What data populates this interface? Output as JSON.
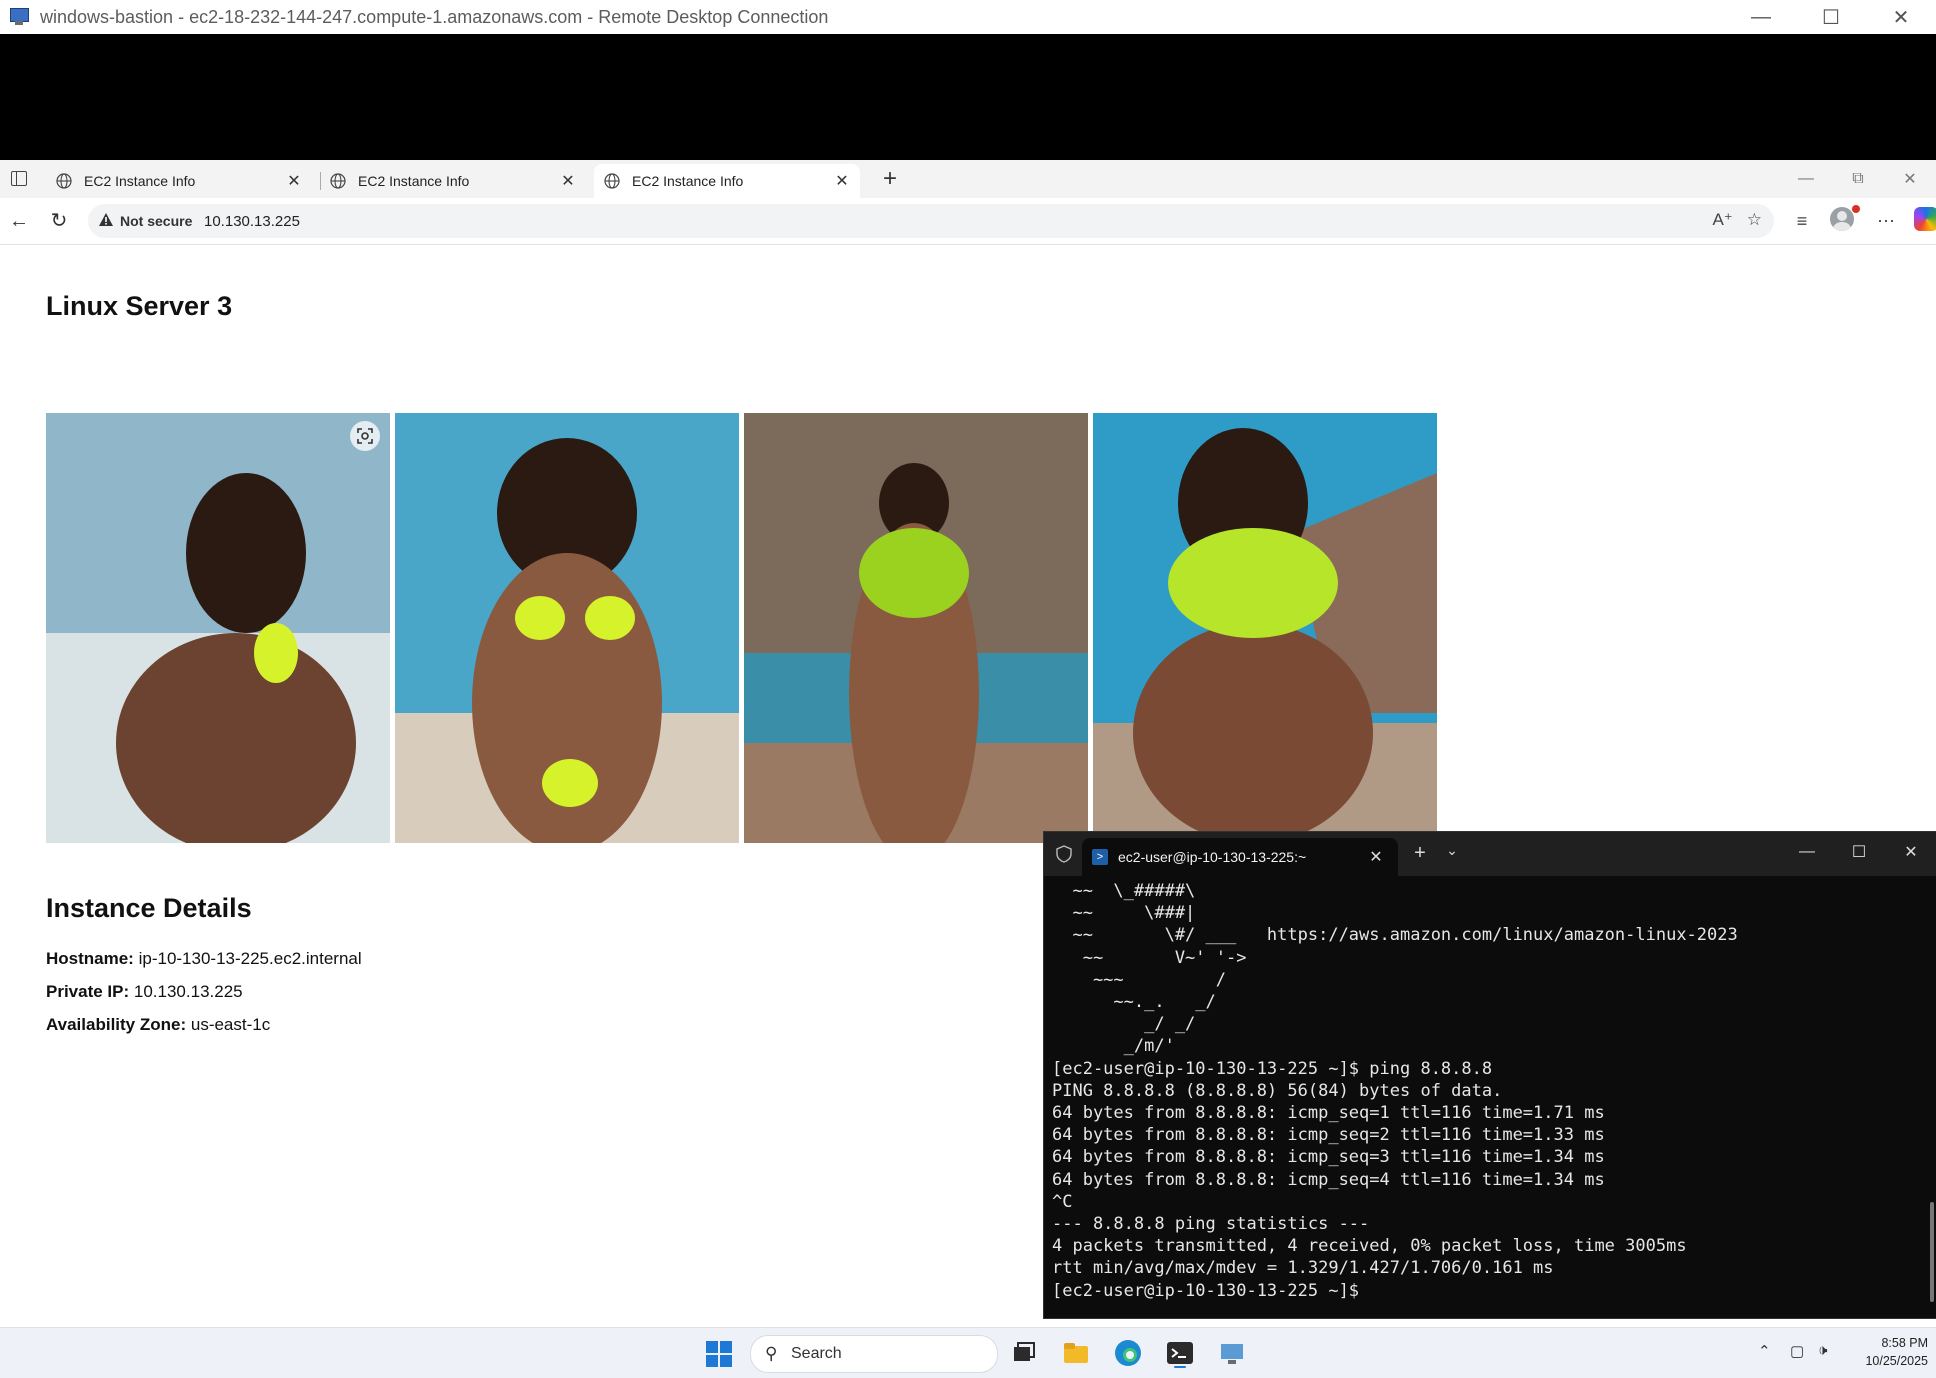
{
  "rdp": {
    "title": "windows-bastion - ec2-18-232-144-247.compute-1.amazonaws.com - Remote Desktop Connection"
  },
  "browser": {
    "tabs": [
      {
        "label": "EC2 Instance Info",
        "icon": "globe-icon",
        "active": false
      },
      {
        "label": "EC2 Instance Info",
        "icon": "globe-icon",
        "active": false
      },
      {
        "label": "EC2 Instance Info",
        "icon": "globe-icon",
        "active": true
      }
    ],
    "not_secure_label": "Not secure",
    "url": "10.130.13.225"
  },
  "page": {
    "title": "Linux Server 3",
    "photos": [
      {
        "icon": "photo",
        "colors": [
          "#8fb6c9",
          "#d9e3e6",
          "#6b4330",
          "#d6f22a"
        ]
      },
      {
        "icon": "photo",
        "colors": [
          "#4aa6c9",
          "#d8cdbd",
          "#8a5a40",
          "#d6f22a"
        ]
      },
      {
        "icon": "photo",
        "colors": [
          "#7c6a5a",
          "#3a8ea8",
          "#9a7a62",
          "#9bd11f"
        ]
      },
      {
        "icon": "photo",
        "colors": [
          "#2f9cc8",
          "#8a6a58",
          "#7a4a35",
          "#b7e52a"
        ]
      }
    ],
    "section_title": "Instance Details",
    "details": [
      {
        "label": "Hostname:",
        "value": "ip-10-130-13-225.ec2.internal"
      },
      {
        "label": "Private IP:",
        "value": "10.130.13.225"
      },
      {
        "label": "Availability Zone:",
        "value": "us-east-1c"
      }
    ]
  },
  "terminal": {
    "tab_label": "ec2-user@ip-10-130-13-225:~",
    "lines": [
      "  ~~  \\_#####\\",
      "  ~~     \\###|",
      "  ~~       \\#/ ___   https://aws.amazon.com/linux/amazon-linux-2023",
      "   ~~       V~' '->",
      "    ~~~         /",
      "      ~~._.   _/",
      "         _/ _/",
      "       _/m/'",
      "[ec2-user@ip-10-130-13-225 ~]$ ping 8.8.8.8",
      "PING 8.8.8.8 (8.8.8.8) 56(84) bytes of data.",
      "64 bytes from 8.8.8.8: icmp_seq=1 ttl=116 time=1.71 ms",
      "64 bytes from 8.8.8.8: icmp_seq=2 ttl=116 time=1.33 ms",
      "64 bytes from 8.8.8.8: icmp_seq=3 ttl=116 time=1.34 ms",
      "64 bytes from 8.8.8.8: icmp_seq=4 ttl=116 time=1.34 ms",
      "^C",
      "--- 8.8.8.8 ping statistics ---",
      "4 packets transmitted, 4 received, 0% packet loss, time 3005ms",
      "rtt min/avg/max/mdev = 1.329/1.427/1.706/0.161 ms",
      "[ec2-user@ip-10-130-13-225 ~]$ "
    ]
  },
  "taskbar": {
    "search_label": "Search",
    "time": "8:58 PM",
    "date": "10/25/2025"
  }
}
